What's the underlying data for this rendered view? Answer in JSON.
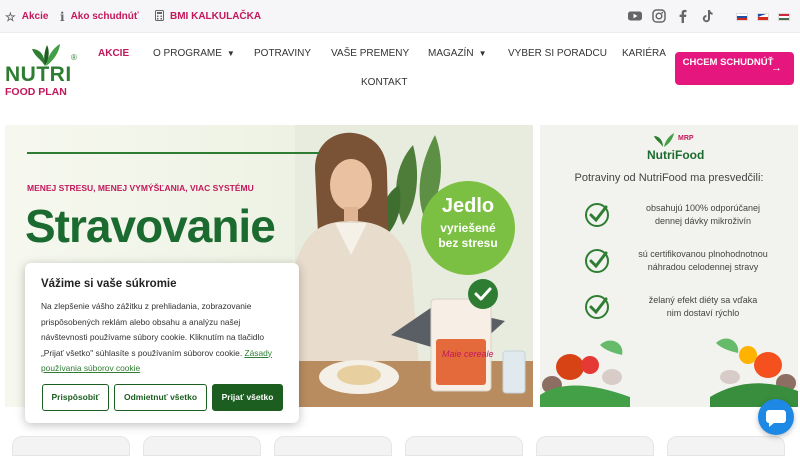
{
  "topbar": {
    "links": [
      {
        "label": "Akcie",
        "icon": "star-icon"
      },
      {
        "label": "Ako schudnúť",
        "icon": "info-icon"
      },
      {
        "label": "BMI KALKULAČKA",
        "icon": "calculator-icon"
      }
    ],
    "social": [
      "youtube-icon",
      "instagram-icon",
      "facebook-icon",
      "tiktok-icon"
    ],
    "flags": [
      "flag-sk-icon",
      "flag-cz-icon",
      "flag-hu-icon"
    ]
  },
  "logo": {
    "word1": "NUTRI",
    "word2": "FOOD PLAN",
    "reg": "®"
  },
  "nav": {
    "items": [
      {
        "label": "AKCIE",
        "active": true
      },
      {
        "label": "O PROGRAME",
        "dropdown": true
      },
      {
        "label": "POTRAVINY"
      },
      {
        "label": "VAŠE PREMENY"
      },
      {
        "label": "MAGAZÍN",
        "dropdown": true
      },
      {
        "label": "VYBER SI PORADCU"
      },
      {
        "label": "KARIÉRA"
      },
      {
        "label": "KONTAKT"
      }
    ],
    "cta": "CHCEM SCHUDNÚŤ"
  },
  "hero": {
    "tagline": "MENEJ STRESU, MENEJ VYMÝŠĽANIA, VIAC SYSTÉMU",
    "title": "Stravovanie",
    "badge": [
      "Jedlo",
      "vyriešené",
      "bez stresu"
    ],
    "pack_label": "Maie cereale"
  },
  "side": {
    "brand_top": "MRP",
    "brand": "NutriFood",
    "intro": "Potraviny od NutriFood ma presvedčili:",
    "points": [
      [
        "obsahujú 100% odporúčanej",
        "dennej dávky mikroživín"
      ],
      [
        "sú certifikovanou plnohodnotnou",
        "náhradou celodennej stravy"
      ],
      [
        "želaný efekt diéty sa vďaka",
        "nim dostaví rýchlo"
      ]
    ]
  },
  "cookie": {
    "title": "Vážime si vaše súkromie",
    "body": "Na zlepšenie vášho zážitku z prehliadania, zobrazovanie prispôsobených reklám alebo obsahu a analýzu našej návštevnosti používame súbory cookie. Kliknutím na tlačidlo „Prijať všetko\" súhlasíte s používaním súborov cookie.",
    "link": "Zásady používania súborov cookie",
    "buttons": {
      "customize": "Prispôsobiť",
      "reject": "Odmietnuť všetko",
      "accept": "Prijať všetko"
    }
  },
  "colors": {
    "brand_green": "#1b6b30",
    "brand_pink": "#e5177e",
    "chat_blue": "#1e88e5"
  }
}
